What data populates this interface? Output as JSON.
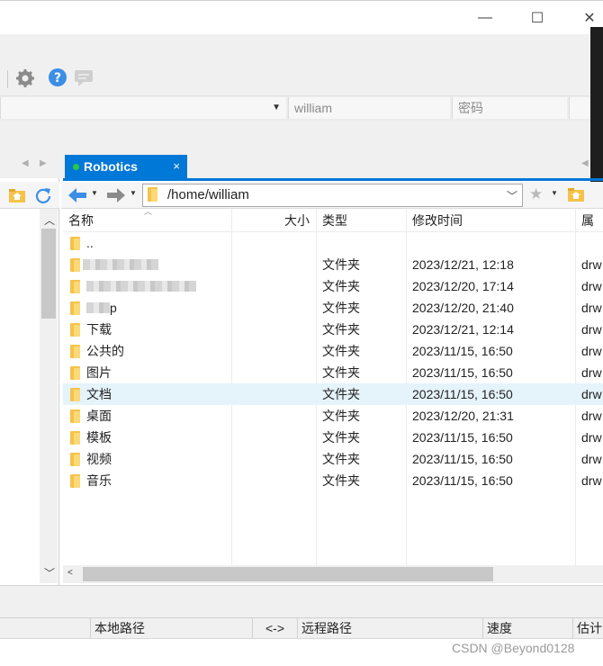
{
  "window": {
    "minimize": "—",
    "maximize": "☐",
    "close": "✕"
  },
  "login": {
    "protocol_placeholder": "",
    "username": "william",
    "password_placeholder": "密码"
  },
  "tab": {
    "label": "Robotics",
    "close": "×"
  },
  "address": {
    "path": "/home/william"
  },
  "columns": {
    "name": "名称",
    "size": "大小",
    "type": "类型",
    "modified": "修改时间",
    "attr": "属性"
  },
  "files": [
    {
      "name": "..",
      "type": "",
      "modified": "",
      "perm": ""
    },
    {
      "name": "",
      "type": "文件夹",
      "modified": "2023/12/21, 12:18",
      "perm": "drw"
    },
    {
      "name": "",
      "type": "文件夹",
      "modified": "2023/12/20, 17:14",
      "perm": "drw"
    },
    {
      "name": "p",
      "type": "文件夹",
      "modified": "2023/12/20, 21:40",
      "perm": "drw"
    },
    {
      "name": "下载",
      "type": "文件夹",
      "modified": "2023/12/21, 12:14",
      "perm": "drw"
    },
    {
      "name": "公共的",
      "type": "文件夹",
      "modified": "2023/11/15, 16:50",
      "perm": "drw"
    },
    {
      "name": "图片",
      "type": "文件夹",
      "modified": "2023/11/15, 16:50",
      "perm": "drw"
    },
    {
      "name": "文档",
      "type": "文件夹",
      "modified": "2023/11/15, 16:50",
      "perm": "drw"
    },
    {
      "name": "桌面",
      "type": "文件夹",
      "modified": "2023/12/20, 21:31",
      "perm": "drw"
    },
    {
      "name": "模板",
      "type": "文件夹",
      "modified": "2023/11/15, 16:50",
      "perm": "drw"
    },
    {
      "name": "视频",
      "type": "文件夹",
      "modified": "2023/11/15, 16:50",
      "perm": "drw"
    },
    {
      "name": "音乐",
      "type": "文件夹",
      "modified": "2023/11/15, 16:50",
      "perm": "drw"
    }
  ],
  "transfer": {
    "local_path": "本地路径",
    "arrow": "<->",
    "remote_path": "远程路径",
    "speed": "速度",
    "estimate": "估计"
  },
  "watermark": "CSDN @Beyond0128",
  "colors": {
    "accent": "#0078d7",
    "selected_row": "#e5f3fb",
    "folder": "#f5c24a"
  }
}
